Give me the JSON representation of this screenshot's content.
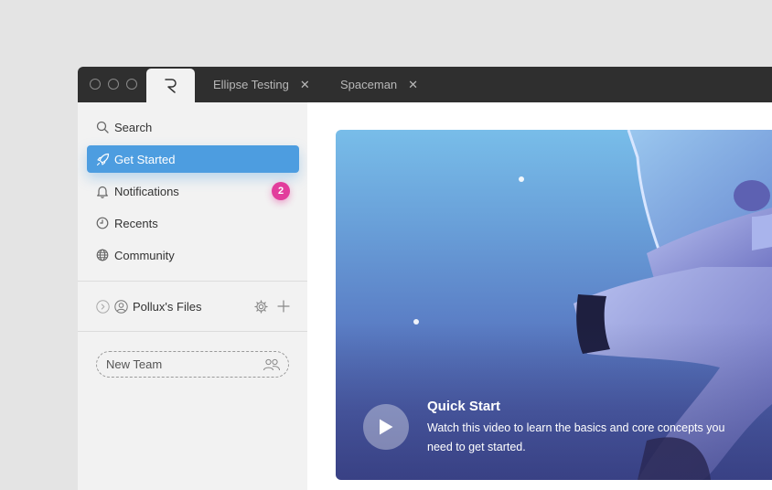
{
  "tabs": [
    {
      "label": "Ellipse Testing"
    },
    {
      "label": "Spaceman"
    }
  ],
  "tab_close_glyph": "✕",
  "sidebar": {
    "items": [
      {
        "label": "Search",
        "icon": "search-icon"
      },
      {
        "label": "Get Started",
        "icon": "rocket-icon",
        "active": true
      },
      {
        "label": "Notifications",
        "icon": "bell-icon",
        "badge": "2"
      },
      {
        "label": "Recents",
        "icon": "clock-icon"
      },
      {
        "label": "Community",
        "icon": "globe-icon"
      }
    ],
    "files": {
      "label": "Pollux's Files"
    },
    "new_team": {
      "placeholder": "New Team"
    }
  },
  "hero": {
    "title": "Quick Start",
    "description": "Watch this video to learn the basics and core concepts you need to get started."
  },
  "colors": {
    "accent": "#4d9de0",
    "badge": "#e23d9c",
    "titlebar": "#2f2f2f"
  }
}
